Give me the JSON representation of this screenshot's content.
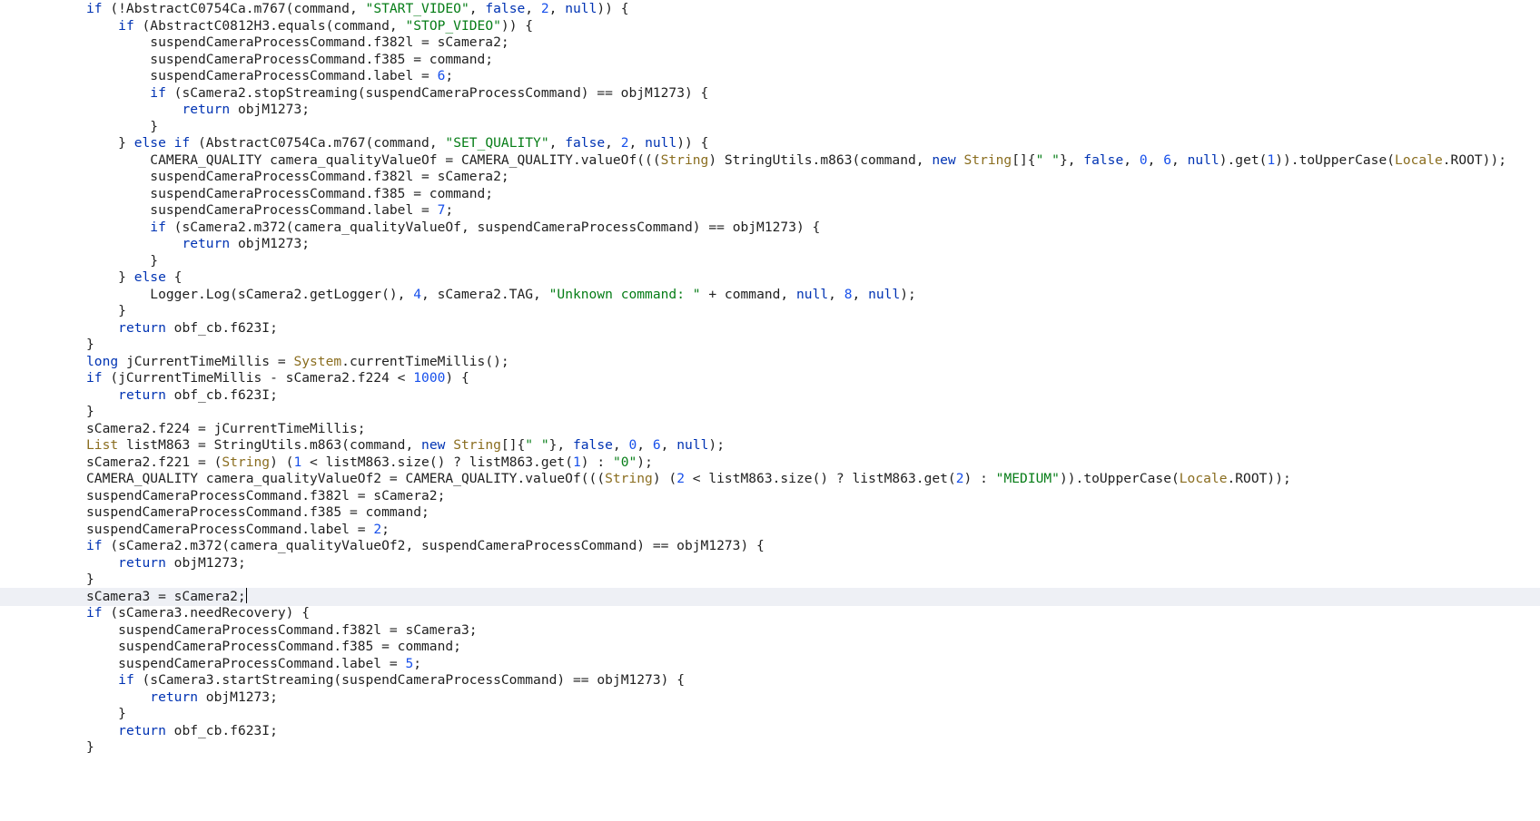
{
  "colors": {
    "background": "#ffffff",
    "current_line": "#eef0f5",
    "text": "#1f1f1f",
    "keyword": "#0033b3",
    "string": "#067d17",
    "number": "#1750eb",
    "type": "#8a6d1f"
  },
  "editor": {
    "caret_line": 35,
    "lines": [
      [
        [
          "i",
          "if"
        ],
        [
          "t",
          " (!AbstractC0754Ca.m767(command, "
        ],
        [
          "s",
          "\"START_VIDEO\""
        ],
        [
          "t",
          ", "
        ],
        [
          "k",
          "false"
        ],
        [
          "t",
          ", "
        ],
        [
          "n",
          "2"
        ],
        [
          "t",
          ", "
        ],
        [
          "k",
          "null"
        ],
        [
          "t",
          ")) {"
        ]
      ],
      [
        [
          "t",
          "    "
        ],
        [
          "i",
          "if"
        ],
        [
          "t",
          " (AbstractC0812H3.equals(command, "
        ],
        [
          "s",
          "\"STOP_VIDEO\""
        ],
        [
          "t",
          ")) {"
        ]
      ],
      [
        [
          "t",
          "        suspendCameraProcessCommand.f382l = sCamera2;"
        ]
      ],
      [
        [
          "t",
          "        suspendCameraProcessCommand.f385 = command;"
        ]
      ],
      [
        [
          "t",
          "        suspendCameraProcessCommand.label = "
        ],
        [
          "n",
          "6"
        ],
        [
          "t",
          ";"
        ]
      ],
      [
        [
          "t",
          "        "
        ],
        [
          "i",
          "if"
        ],
        [
          "t",
          " (sCamera2.stopStreaming(suspendCameraProcessCommand) == objM1273) {"
        ]
      ],
      [
        [
          "t",
          "            "
        ],
        [
          "i",
          "return"
        ],
        [
          "t",
          " objM1273;"
        ]
      ],
      [
        [
          "t",
          "        }"
        ]
      ],
      [
        [
          "t",
          "    } "
        ],
        [
          "i",
          "else if"
        ],
        [
          "t",
          " (AbstractC0754Ca.m767(command, "
        ],
        [
          "s",
          "\"SET_QUALITY\""
        ],
        [
          "t",
          ", "
        ],
        [
          "k",
          "false"
        ],
        [
          "t",
          ", "
        ],
        [
          "n",
          "2"
        ],
        [
          "t",
          ", "
        ],
        [
          "k",
          "null"
        ],
        [
          "t",
          ")) {"
        ]
      ],
      [
        [
          "t",
          "        CAMERA_QUALITY camera_qualityValueOf = CAMERA_QUALITY.valueOf((("
        ],
        [
          "c",
          "String"
        ],
        [
          "t",
          ") StringUtils.m863(command, "
        ],
        [
          "k",
          "new"
        ],
        [
          "t",
          " "
        ],
        [
          "c",
          "String"
        ],
        [
          "t",
          "[]{"
        ],
        [
          "s",
          "\" \""
        ],
        [
          "t",
          "}, "
        ],
        [
          "k",
          "false"
        ],
        [
          "t",
          ", "
        ],
        [
          "n",
          "0"
        ],
        [
          "t",
          ", "
        ],
        [
          "n",
          "6"
        ],
        [
          "t",
          ", "
        ],
        [
          "k",
          "null"
        ],
        [
          "t",
          ").get("
        ],
        [
          "n",
          "1"
        ],
        [
          "t",
          ")).toUpperCase("
        ],
        [
          "c",
          "Locale"
        ],
        [
          "t",
          ".ROOT));"
        ]
      ],
      [
        [
          "t",
          "        suspendCameraProcessCommand.f382l = sCamera2;"
        ]
      ],
      [
        [
          "t",
          "        suspendCameraProcessCommand.f385 = command;"
        ]
      ],
      [
        [
          "t",
          "        suspendCameraProcessCommand.label = "
        ],
        [
          "n",
          "7"
        ],
        [
          "t",
          ";"
        ]
      ],
      [
        [
          "t",
          "        "
        ],
        [
          "i",
          "if"
        ],
        [
          "t",
          " (sCamera2.m372(camera_qualityValueOf, suspendCameraProcessCommand) == objM1273) {"
        ]
      ],
      [
        [
          "t",
          "            "
        ],
        [
          "i",
          "return"
        ],
        [
          "t",
          " objM1273;"
        ]
      ],
      [
        [
          "t",
          "        }"
        ]
      ],
      [
        [
          "t",
          "    } "
        ],
        [
          "i",
          "else"
        ],
        [
          "t",
          " {"
        ]
      ],
      [
        [
          "t",
          "        Logger.Log(sCamera2.getLogger(), "
        ],
        [
          "n",
          "4"
        ],
        [
          "t",
          ", sCamera2.TAG, "
        ],
        [
          "s",
          "\"Unknown command: \""
        ],
        [
          "t",
          " + command, "
        ],
        [
          "k",
          "null"
        ],
        [
          "t",
          ", "
        ],
        [
          "n",
          "8"
        ],
        [
          "t",
          ", "
        ],
        [
          "k",
          "null"
        ],
        [
          "t",
          ");"
        ]
      ],
      [
        [
          "t",
          "    }"
        ]
      ],
      [
        [
          "t",
          "    "
        ],
        [
          "i",
          "return"
        ],
        [
          "t",
          " obf_cb.f623I;"
        ]
      ],
      [
        [
          "t",
          "}"
        ]
      ],
      [
        [
          "i",
          "long"
        ],
        [
          "t",
          " jCurrentTimeMillis = "
        ],
        [
          "c",
          "System"
        ],
        [
          "t",
          ".currentTimeMillis();"
        ]
      ],
      [
        [
          "i",
          "if"
        ],
        [
          "t",
          " (jCurrentTimeMillis - sCamera2.f224 < "
        ],
        [
          "n",
          "1000"
        ],
        [
          "t",
          ") {"
        ]
      ],
      [
        [
          "t",
          "    "
        ],
        [
          "i",
          "return"
        ],
        [
          "t",
          " obf_cb.f623I;"
        ]
      ],
      [
        [
          "t",
          "}"
        ]
      ],
      [
        [
          "t",
          "sCamera2.f224 = jCurrentTimeMillis;"
        ]
      ],
      [
        [
          "c",
          "List"
        ],
        [
          "t",
          " listM863 = StringUtils.m863(command, "
        ],
        [
          "k",
          "new"
        ],
        [
          "t",
          " "
        ],
        [
          "c",
          "String"
        ],
        [
          "t",
          "[]{"
        ],
        [
          "s",
          "\" \""
        ],
        [
          "t",
          "}, "
        ],
        [
          "k",
          "false"
        ],
        [
          "t",
          ", "
        ],
        [
          "n",
          "0"
        ],
        [
          "t",
          ", "
        ],
        [
          "n",
          "6"
        ],
        [
          "t",
          ", "
        ],
        [
          "k",
          "null"
        ],
        [
          "t",
          ");"
        ]
      ],
      [
        [
          "t",
          "sCamera2.f221 = ("
        ],
        [
          "c",
          "String"
        ],
        [
          "t",
          ") ("
        ],
        [
          "n",
          "1"
        ],
        [
          "t",
          " < listM863.size() ? listM863.get("
        ],
        [
          "n",
          "1"
        ],
        [
          "t",
          ") : "
        ],
        [
          "s",
          "\"0\""
        ],
        [
          "t",
          ");"
        ]
      ],
      [
        [
          "t",
          "CAMERA_QUALITY camera_qualityValueOf2 = CAMERA_QUALITY.valueOf((("
        ],
        [
          "c",
          "String"
        ],
        [
          "t",
          ") ("
        ],
        [
          "n",
          "2"
        ],
        [
          "t",
          " < listM863.size() ? listM863.get("
        ],
        [
          "n",
          "2"
        ],
        [
          "t",
          ") : "
        ],
        [
          "s",
          "\"MEDIUM\""
        ],
        [
          "t",
          ")).toUpperCase("
        ],
        [
          "c",
          "Locale"
        ],
        [
          "t",
          ".ROOT));"
        ]
      ],
      [
        [
          "t",
          "suspendCameraProcessCommand.f382l = sCamera2;"
        ]
      ],
      [
        [
          "t",
          "suspendCameraProcessCommand.f385 = command;"
        ]
      ],
      [
        [
          "t",
          "suspendCameraProcessCommand.label = "
        ],
        [
          "n",
          "2"
        ],
        [
          "t",
          ";"
        ]
      ],
      [
        [
          "i",
          "if"
        ],
        [
          "t",
          " (sCamera2.m372(camera_qualityValueOf2, suspendCameraProcessCommand) == objM1273) {"
        ]
      ],
      [
        [
          "t",
          "    "
        ],
        [
          "i",
          "return"
        ],
        [
          "t",
          " objM1273;"
        ]
      ],
      [
        [
          "t",
          "}"
        ]
      ],
      [
        [
          "t",
          "sCamera3 = sCamera2;"
        ]
      ],
      [
        [
          "i",
          "if"
        ],
        [
          "t",
          " (sCamera3.needRecovery) {"
        ]
      ],
      [
        [
          "t",
          "    suspendCameraProcessCommand.f382l = sCamera3;"
        ]
      ],
      [
        [
          "t",
          "    suspendCameraProcessCommand.f385 = command;"
        ]
      ],
      [
        [
          "t",
          "    suspendCameraProcessCommand.label = "
        ],
        [
          "n",
          "5"
        ],
        [
          "t",
          ";"
        ]
      ],
      [
        [
          "t",
          "    "
        ],
        [
          "i",
          "if"
        ],
        [
          "t",
          " (sCamera3.startStreaming(suspendCameraProcessCommand) == objM1273) {"
        ]
      ],
      [
        [
          "t",
          "        "
        ],
        [
          "i",
          "return"
        ],
        [
          "t",
          " objM1273;"
        ]
      ],
      [
        [
          "t",
          "    }"
        ]
      ],
      [
        [
          "t",
          "    "
        ],
        [
          "i",
          "return"
        ],
        [
          "t",
          " obf_cb.f623I;"
        ]
      ],
      [
        [
          "t",
          "}"
        ]
      ]
    ]
  }
}
